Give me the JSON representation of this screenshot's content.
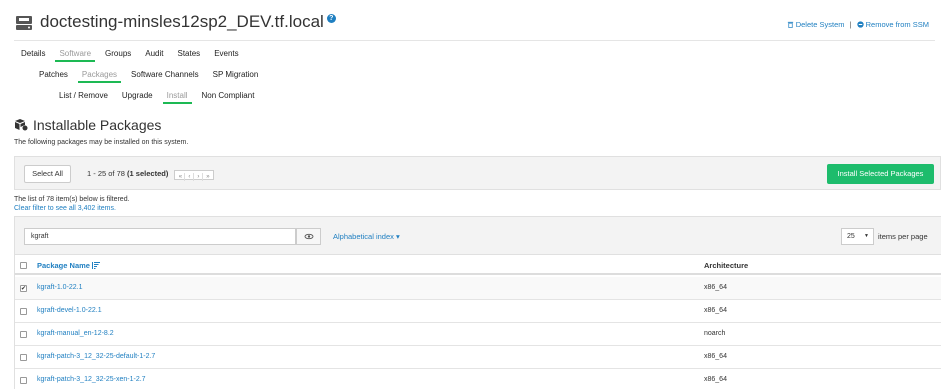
{
  "header": {
    "title": "doctesting-minsles12sp2_DEV.tf.local",
    "delete_label": "Delete System",
    "separator": "|",
    "remove_label": "Remove from SSM"
  },
  "tabs_main": [
    "Details",
    "Software",
    "Groups",
    "Audit",
    "States",
    "Events"
  ],
  "tabs_sub": [
    "Patches",
    "Packages",
    "Software Channels",
    "SP Migration"
  ],
  "tabs_sub2": [
    "List / Remove",
    "Upgrade",
    "Install",
    "Non Compliant"
  ],
  "section": {
    "title": "Installable Packages",
    "description": "The following packages may be installed on this system."
  },
  "toolbar": {
    "select_all": "Select All",
    "pager_prefix": "1 - 25 of 78",
    "pager_selected": "(1 selected)",
    "pager_first": "«",
    "pager_prev": "‹",
    "pager_next": "›",
    "pager_last": "»",
    "install_button": "Install Selected Packages"
  },
  "filter_note": "The list of 78 item(s) below is filtered.",
  "filter_link": "Clear filter to see all 3,402 items.",
  "filter": {
    "value": "kgraft",
    "alpha_index": "Alphabetical index ▾",
    "per_page_value": "25",
    "per_page_caret": "▼",
    "per_page_label": "items per page"
  },
  "table": {
    "col_name": "Package Name",
    "col_arch": "Architecture",
    "rows": [
      {
        "name": "kgraft-1.0-22.1",
        "arch": "x86_64",
        "checked": true
      },
      {
        "name": "kgraft-devel-1.0-22.1",
        "arch": "x86_64",
        "checked": false
      },
      {
        "name": "kgraft-manual_en-12-8.2",
        "arch": "noarch",
        "checked": false
      },
      {
        "name": "kgraft-patch-3_12_32-25-default-1-2.7",
        "arch": "x86_64",
        "checked": false
      },
      {
        "name": "kgraft-patch-3_12_32-25-xen-1-2.7",
        "arch": "x86_64",
        "checked": false
      }
    ]
  },
  "check_mark": "✔",
  "help_glyph": "?",
  "colors": {
    "accent_green": "#1db954",
    "link_blue": "#1f7fc1",
    "install_green": "#1dbc6c"
  },
  "icons": {
    "system": "server-icon",
    "help": "help-icon",
    "delete": "trash-icon",
    "remove": "minus-circle-icon",
    "section": "packages-icon",
    "filter_toggle": "eye-icon",
    "sort": "sort-alpha-icon"
  }
}
